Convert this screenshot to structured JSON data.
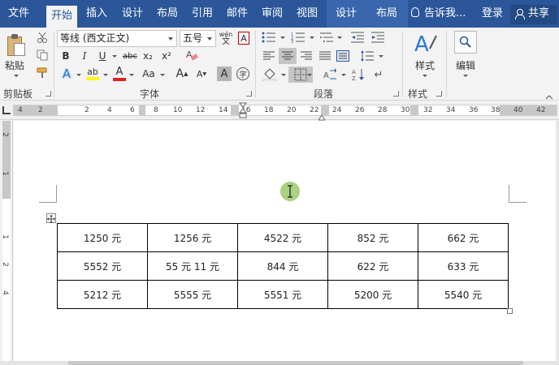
{
  "tabs": [
    {
      "label": "文件",
      "active": false
    },
    {
      "label": "开始",
      "active": true
    },
    {
      "label": "插入",
      "active": false
    },
    {
      "label": "设计",
      "active": false
    },
    {
      "label": "布局",
      "active": false
    },
    {
      "label": "引用",
      "active": false
    },
    {
      "label": "邮件",
      "active": false
    },
    {
      "label": "审阅",
      "active": false
    },
    {
      "label": "视图",
      "active": false
    }
  ],
  "context_tabs": [
    "设计",
    "布局"
  ],
  "tell_me": "告诉我...",
  "login": "登录",
  "share": "共享",
  "clipboard": {
    "paste_label": "粘贴",
    "group_label": "剪贴板"
  },
  "font": {
    "name": "等线 (西文正文)",
    "size": "五号",
    "group_label": "字体",
    "bold": "B",
    "italic": "I",
    "underline": "U",
    "strikethrough": "abc",
    "subscript": "x₂",
    "superscript": "x²",
    "text_effect": "A",
    "font_color": "A",
    "highlight": "ab",
    "change_case": "Aa",
    "grow": "A",
    "shrink": "A",
    "char_shading": "A",
    "enclose_char": "字",
    "phonetic": "wén",
    "clear_format": "A",
    "colors": {
      "highlight": "#ffff00",
      "font_color": "#e01f1f",
      "char_border": "#c00000"
    }
  },
  "paragraph": {
    "group_label": "段落"
  },
  "styles": {
    "label": "样式",
    "group_label": "样式"
  },
  "editing": {
    "label": "编辑"
  },
  "ruler": {
    "numbers": [
      "4",
      "2",
      "2",
      "4",
      "6",
      "8",
      "10",
      "12",
      "14",
      "16",
      "18",
      "20",
      "22",
      "24",
      "26",
      "28",
      "30",
      "32",
      "34",
      "36",
      "38",
      "40",
      "42"
    ]
  },
  "vruler": {
    "numbers": [
      "2",
      "1",
      "1",
      "2",
      "4"
    ]
  },
  "table": {
    "rows": [
      [
        "1250 元",
        "1256 元",
        "4522 元",
        "852 元",
        "662 元"
      ],
      [
        "5552 元",
        "55 元 11 元",
        "844 元",
        "622 元",
        "633 元"
      ],
      [
        "5212 元",
        "5555 元",
        "5551 元",
        "5200 元",
        "5540 元"
      ]
    ]
  },
  "colors": {
    "accent": "#2b579a",
    "cursor_highlight": "#9cc96b"
  }
}
